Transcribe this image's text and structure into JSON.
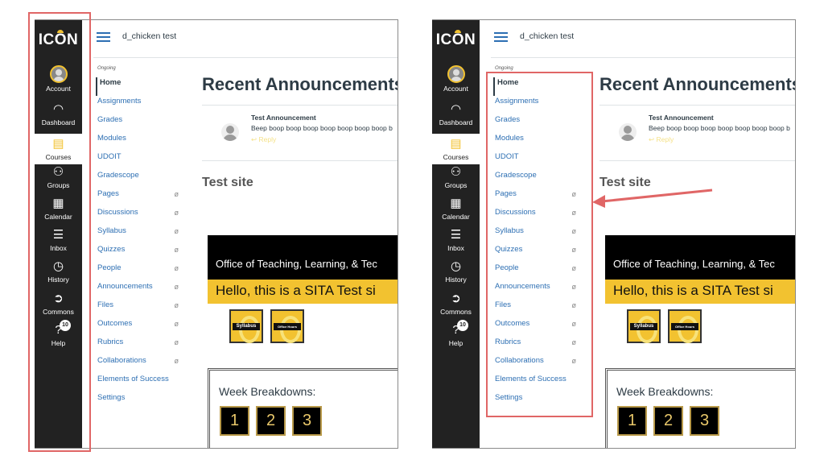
{
  "global_nav": {
    "logo": "ICON",
    "items": [
      {
        "label": "Account",
        "icon": "avatar-icon"
      },
      {
        "label": "Dashboard",
        "icon": "speedometer-icon"
      },
      {
        "label": "Courses",
        "icon": "book-icon",
        "active": true
      },
      {
        "label": "Groups",
        "icon": "people-icon"
      },
      {
        "label": "Calendar",
        "icon": "calendar-icon"
      },
      {
        "label": "Inbox",
        "icon": "inbox-icon"
      },
      {
        "label": "History",
        "icon": "clock-icon"
      },
      {
        "label": "Commons",
        "icon": "commons-icon"
      },
      {
        "label": "Help",
        "icon": "help-icon",
        "badge": "10"
      }
    ]
  },
  "header": {
    "course_title": "d_chicken test"
  },
  "course_nav": {
    "term": "Ongoing",
    "items": [
      {
        "label": "Home",
        "active": true,
        "hidden": false
      },
      {
        "label": "Assignments",
        "hidden": false
      },
      {
        "label": "Grades",
        "hidden": false
      },
      {
        "label": "Modules",
        "hidden": false
      },
      {
        "label": "UDOIT",
        "hidden": false
      },
      {
        "label": "Gradescope",
        "hidden": false
      },
      {
        "label": "Pages",
        "hidden": true
      },
      {
        "label": "Discussions",
        "hidden": true
      },
      {
        "label": "Syllabus",
        "hidden": true
      },
      {
        "label": "Quizzes",
        "hidden": true
      },
      {
        "label": "People",
        "hidden": true
      },
      {
        "label": "Announcements",
        "hidden": true
      },
      {
        "label": "Files",
        "hidden": true
      },
      {
        "label": "Outcomes",
        "hidden": true
      },
      {
        "label": "Rubrics",
        "hidden": true
      },
      {
        "label": "Collaborations",
        "hidden": true
      },
      {
        "label": "Elements of Success",
        "hidden": false
      },
      {
        "label": "Settings",
        "hidden": false
      }
    ],
    "hidden_icon": "eye-slash-icon"
  },
  "main": {
    "announcements_heading": "Recent Announcements",
    "announcement": {
      "title": "Test Announcement",
      "body": "Beep boop boop boop boop boop boop boop b",
      "reply": "Reply"
    },
    "site_heading": "Test site",
    "banner_black": "Office of Teaching, Learning, & Tec",
    "banner_yellow": "Hello, this is a SITA Test si",
    "tiles": [
      "Syllabus",
      "Office Hours"
    ],
    "week_label": "Week Breakdowns:",
    "weeks": [
      "1",
      "2",
      "3"
    ]
  },
  "colors": {
    "accent_yellow": "#f2c230",
    "nav_dark": "#222222",
    "link_blue": "#2d6fb3",
    "highlight_red": "#e06666"
  }
}
